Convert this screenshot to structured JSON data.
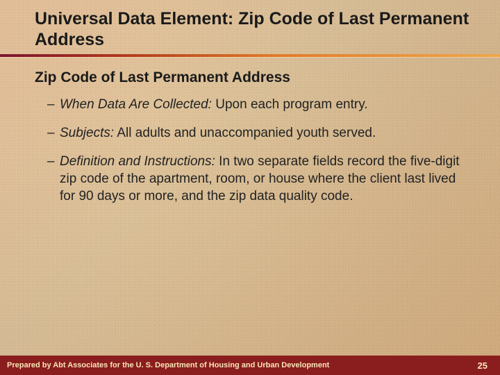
{
  "title": "Universal Data Element: Zip Code of Last Permanent Address",
  "subhead": "Zip Code of Last Permanent Address",
  "bullets": [
    {
      "label": "When Data Are Collected:",
      "text": " Upon each program entry."
    },
    {
      "label": "Subjects:",
      "text": "  All adults and unaccompanied youth served."
    },
    {
      "label": "Definition and Instructions:",
      "text": " In two separate fields record the five-digit zip code of the apartment, room, or house where the client last lived for 90 days or more, and the zip data quality code."
    }
  ],
  "footer": {
    "credit": "Prepared by Abt Associates for the U. S. Department of Housing and Urban Development",
    "page": "25"
  }
}
